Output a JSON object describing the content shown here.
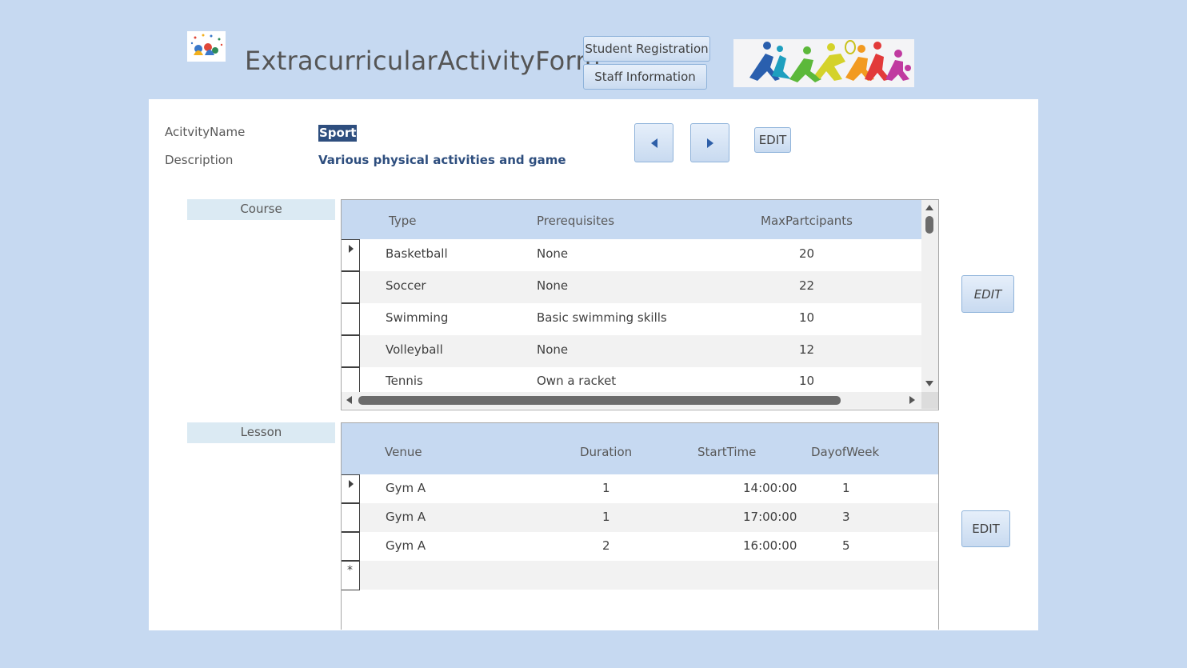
{
  "header": {
    "title": "ExtracurricularActivityForm",
    "student_registration_label": "Student Registration",
    "staff_information_label": "Staff Information",
    "logo_icon": "activity-logo-icon",
    "banner_image": "sports-figures-image"
  },
  "record": {
    "name_label": "AcitvityName",
    "name_value": "Sport",
    "description_label": "Description",
    "description_value": "Various physical activities and game",
    "prev_icon": "triangle-left-icon",
    "next_icon": "triangle-right-icon",
    "edit_label": "EDIT"
  },
  "course": {
    "section_label": "Course",
    "columns": [
      "Type",
      "Prerequisites",
      "MaxPartcipants"
    ],
    "rows": [
      [
        "Basketball",
        "None",
        "20"
      ],
      [
        "Soccer",
        "None",
        "22"
      ],
      [
        "Swimming",
        "Basic swimming skills",
        "10"
      ],
      [
        "Volleyball",
        "None",
        "12"
      ],
      [
        "Tennis",
        "Own a racket",
        "10"
      ]
    ],
    "edit_label": "EDIT"
  },
  "lesson": {
    "section_label": "Lesson",
    "columns": [
      "Venue",
      "Duration",
      "StartTime",
      "DayofWeek"
    ],
    "rows": [
      [
        "Gym A",
        "1",
        "14:00:00",
        "1"
      ],
      [
        "Gym A",
        "1",
        "17:00:00",
        "3"
      ],
      [
        "Gym A",
        "2",
        "16:00:00",
        "5"
      ]
    ],
    "new_row_marker": "*",
    "edit_label": "EDIT"
  },
  "colors": {
    "page_background": "#c6d9f1",
    "grid_header": "#c6d9f1",
    "selected_text_bg": "#2e4e7e",
    "description_text": "#2e4e7e"
  }
}
